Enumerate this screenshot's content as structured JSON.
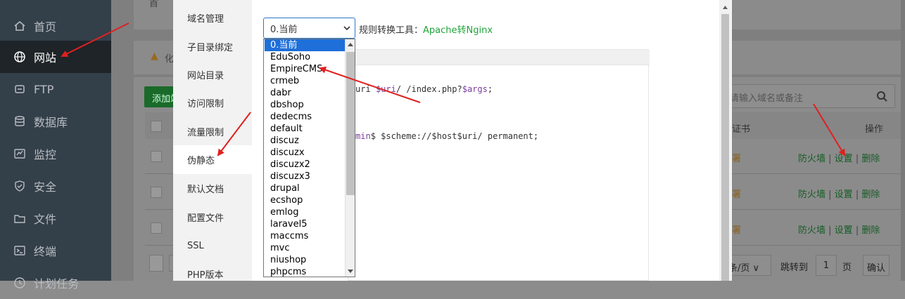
{
  "sidebar": {
    "items": [
      {
        "label": "首页",
        "icon": "home-icon"
      },
      {
        "label": "网站",
        "icon": "globe-icon",
        "active": true
      },
      {
        "label": "FTP",
        "icon": "ftp-icon"
      },
      {
        "label": "数据库",
        "icon": "database-icon"
      },
      {
        "label": "监控",
        "icon": "monitor-icon"
      },
      {
        "label": "安全",
        "icon": "shield-icon"
      },
      {
        "label": "文件",
        "icon": "folder-icon"
      },
      {
        "label": "终端",
        "icon": "terminal-icon"
      },
      {
        "label": "计划任务",
        "icon": "clock-icon"
      }
    ]
  },
  "background": {
    "breadcrumb": "首",
    "add_button": "添加站",
    "warn_prefix": "化",
    "search_placeholder": "请输入域名或备注",
    "col_cert": "证书",
    "col_ops": "操作",
    "rows": [
      {
        "cert": "署",
        "firewall": "防火墙",
        "settings": "设置",
        "delete": "删除"
      },
      {
        "cert": "署",
        "firewall": "防火墙",
        "settings": "设置",
        "delete": "删除"
      },
      {
        "cert": "署",
        "firewall": "防火墙",
        "settings": "设置",
        "delete": "删除"
      }
    ],
    "pager_per_page": "条/页",
    "jump_to": "跳转到",
    "page_num": "1",
    "page_unit": "页",
    "confirm": "确认"
  },
  "modal": {
    "tabs": [
      "域名管理",
      "子目录绑定",
      "网站目录",
      "访问限制",
      "流量限制",
      "伪静态",
      "默认文档",
      "配置文件",
      "SSL",
      "PHP版本"
    ],
    "active_tab": "伪静态",
    "select_value": "0.当前",
    "tool_label": "规则转换工具：",
    "tool_link": "Apache转Nginx",
    "code": {
      "line1_a": "uri ",
      "line1_var": "$uri",
      "line1_b": "/ /index.php?",
      "line1_var2": "$args",
      "line1_c": ";",
      "line2_a": "min",
      "line2_b": "$ $scheme://$host$uri/ permanent;"
    },
    "options": [
      "0.当前",
      "EduSoho",
      "EmpireCMS",
      "crmeb",
      "dabr",
      "dbshop",
      "dedecms",
      "default",
      "discuz",
      "discuzx",
      "discuzx2",
      "discuzx3",
      "drupal",
      "ecshop",
      "emlog",
      "laravel5",
      "maccms",
      "mvc",
      "niushop",
      "phpcms"
    ]
  },
  "colors": {
    "sidebar_bg": "#333f49",
    "accent_green": "#20a53a",
    "selection_blue": "#1e6fd9",
    "annotation_red": "#e02020"
  }
}
